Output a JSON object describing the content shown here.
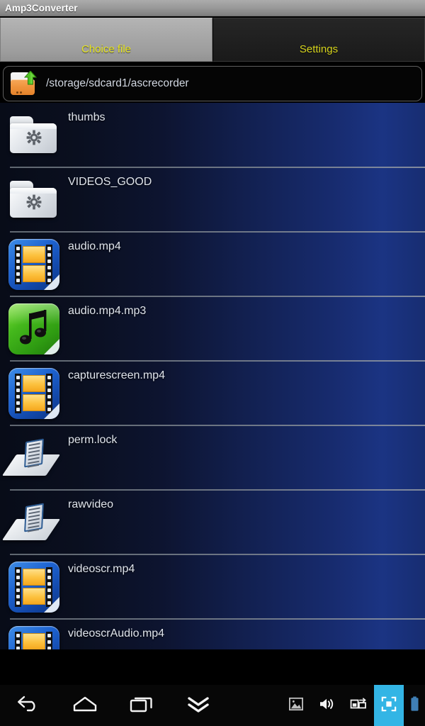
{
  "window": {
    "app_title": "Amp3Converter"
  },
  "tabs": [
    {
      "label": "Choice file",
      "active": true,
      "name": "tab-choice-file"
    },
    {
      "label": "Settings",
      "active": false,
      "name": "tab-settings"
    }
  ],
  "path_bar": {
    "icon": "folder-up-icon",
    "path": "/storage/sdcard1/ascrecorder"
  },
  "file_list": [
    {
      "name": "thumbs",
      "type": "folder",
      "icon": "folder-gear-icon"
    },
    {
      "name": "VIDEOS_GOOD",
      "type": "folder",
      "icon": "folder-gear-icon"
    },
    {
      "name": "audio.mp4",
      "type": "video",
      "icon": "video-file-icon"
    },
    {
      "name": "audio.mp4.mp3",
      "type": "audio",
      "icon": "audio-file-icon"
    },
    {
      "name": "capturescreen.mp4",
      "type": "video",
      "icon": "video-file-icon"
    },
    {
      "name": "perm.lock",
      "type": "file",
      "icon": "generic-file-icon"
    },
    {
      "name": "rawvideo",
      "type": "file",
      "icon": "generic-file-icon"
    },
    {
      "name": "videoscr.mp4",
      "type": "video",
      "icon": "video-file-icon"
    },
    {
      "name": "videoscrAudio.mp4",
      "type": "video",
      "icon": "video-file-icon"
    }
  ],
  "navbar": {
    "buttons": [
      {
        "name": "back-button",
        "icon": "back-arrow-icon"
      },
      {
        "name": "home-button",
        "icon": "home-icon"
      },
      {
        "name": "recents-button",
        "icon": "recent-apps-icon"
      },
      {
        "name": "hide-button",
        "icon": "double-chevron-down-icon"
      }
    ],
    "status_icons": [
      {
        "name": "gallery-button",
        "icon": "image-icon"
      },
      {
        "name": "volume-button",
        "icon": "speaker-icon"
      },
      {
        "name": "multiwindow-button",
        "icon": "window-transfer-icon"
      },
      {
        "name": "fullscreen-button",
        "icon": "fullscreen-icon",
        "highlight": true
      },
      {
        "name": "battery-indicator",
        "icon": "battery-icon"
      }
    ]
  },
  "colors": {
    "tab_text": "#e9e720",
    "list_gradient_start": "#080c18",
    "list_gradient_end": "#1b3483",
    "highlight": "#33b5e5"
  }
}
